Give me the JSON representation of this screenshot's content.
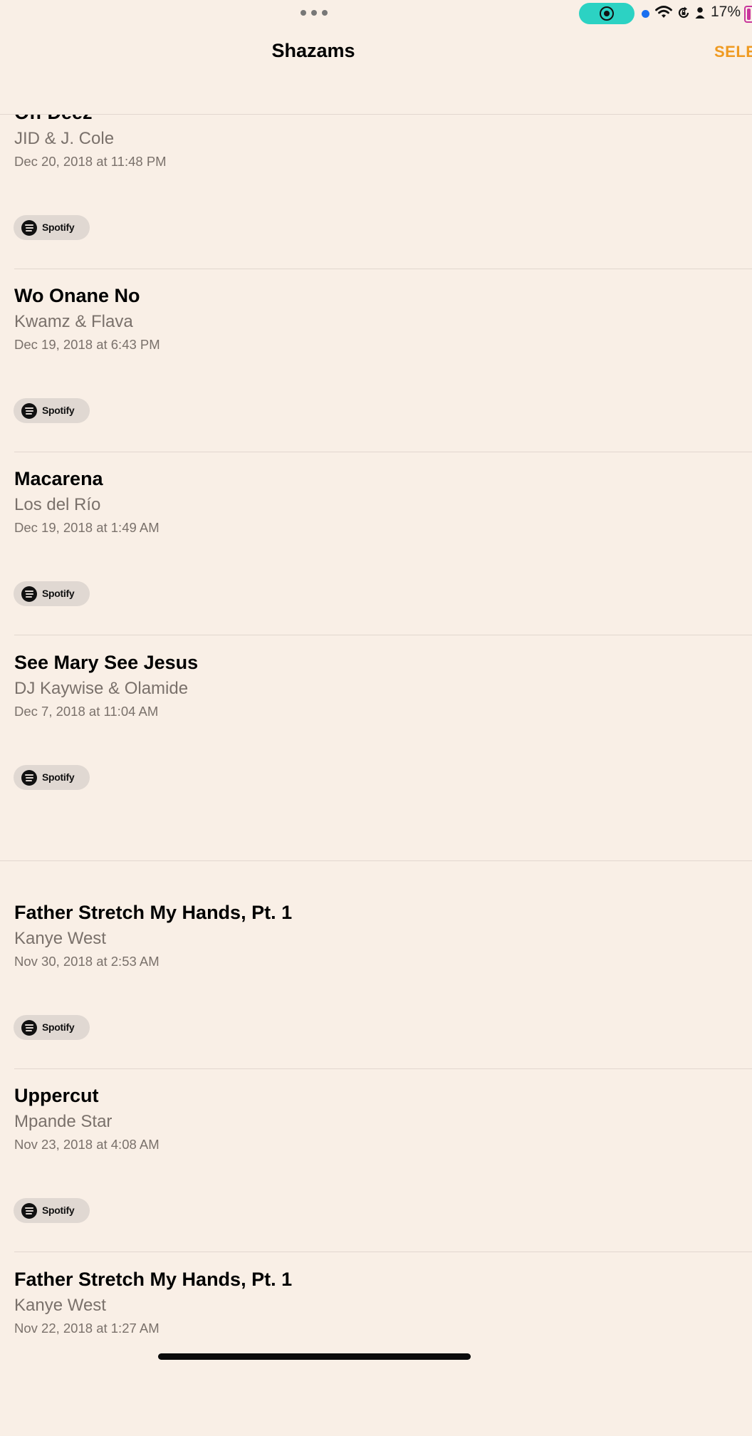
{
  "status_bar": {
    "battery_percent": "17%",
    "colors": {
      "record_pill": "#2cd2c3",
      "privacy_dot": "#1a6ff0",
      "battery": "#c8359c"
    }
  },
  "nav": {
    "title": "Shazams",
    "select_label": "SELE",
    "accent_color": "#ef9a21"
  },
  "shazams": [
    {
      "title": "Off Deez",
      "artist": "JID & J. Cole",
      "date": "Dec 20, 2018 at 11:48 PM",
      "service_label": "Spotify"
    },
    {
      "title": "Wo Onane No",
      "artist": "Kwamz & Flava",
      "date": "Dec 19, 2018 at 6:43 PM",
      "service_label": "Spotify"
    },
    {
      "title": "Macarena",
      "artist": "Los del Río",
      "date": "Dec 19, 2018 at 1:49 AM",
      "service_label": "Spotify"
    },
    {
      "title": "See Mary See Jesus",
      "artist": "DJ Kaywise & Olamide",
      "date": "Dec 7, 2018 at 11:04 AM",
      "service_label": "Spotify"
    },
    {
      "title": "Father Stretch My Hands, Pt. 1",
      "artist": "Kanye West",
      "date": "Nov 30, 2018 at 2:53 AM",
      "service_label": "Spotify"
    },
    {
      "title": "Uppercut",
      "artist": "Mpande Star",
      "date": "Nov 23, 2018 at 4:08 AM",
      "service_label": "Spotify"
    },
    {
      "title": "Father Stretch My Hands, Pt. 1",
      "artist": "Kanye West",
      "date": "Nov 22, 2018 at 1:27 AM",
      "service_label": "Spotify"
    }
  ]
}
